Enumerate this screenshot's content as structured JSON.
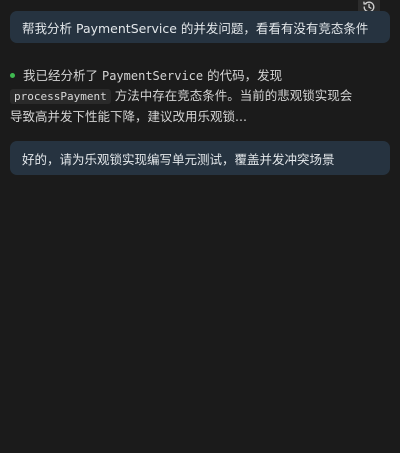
{
  "header": {
    "history_icon": "history-icon"
  },
  "conversation": {
    "user_message_1": "帮我分析 PaymentService 的并发问题，看看有没有竞态条件",
    "assistant": {
      "status_color": "#3fb950",
      "line1_prefix": "我已经分析了 ",
      "line1_code": "PaymentService",
      "line1_suffix": " 的代码，发现",
      "line2_code": "processPayment",
      "line2_suffix": " 方法中存在竞态条件。当前的悲观锁实现会",
      "line3": "导致高并发下性能下降，建议改用乐观锁..."
    },
    "user_message_2": "好的，请为乐观锁实现编写单元测试，覆盖并发冲突场景"
  },
  "colors": {
    "background": "#1b1b1b",
    "user_bubble": "#263340",
    "status_dot": "#3fb950"
  }
}
